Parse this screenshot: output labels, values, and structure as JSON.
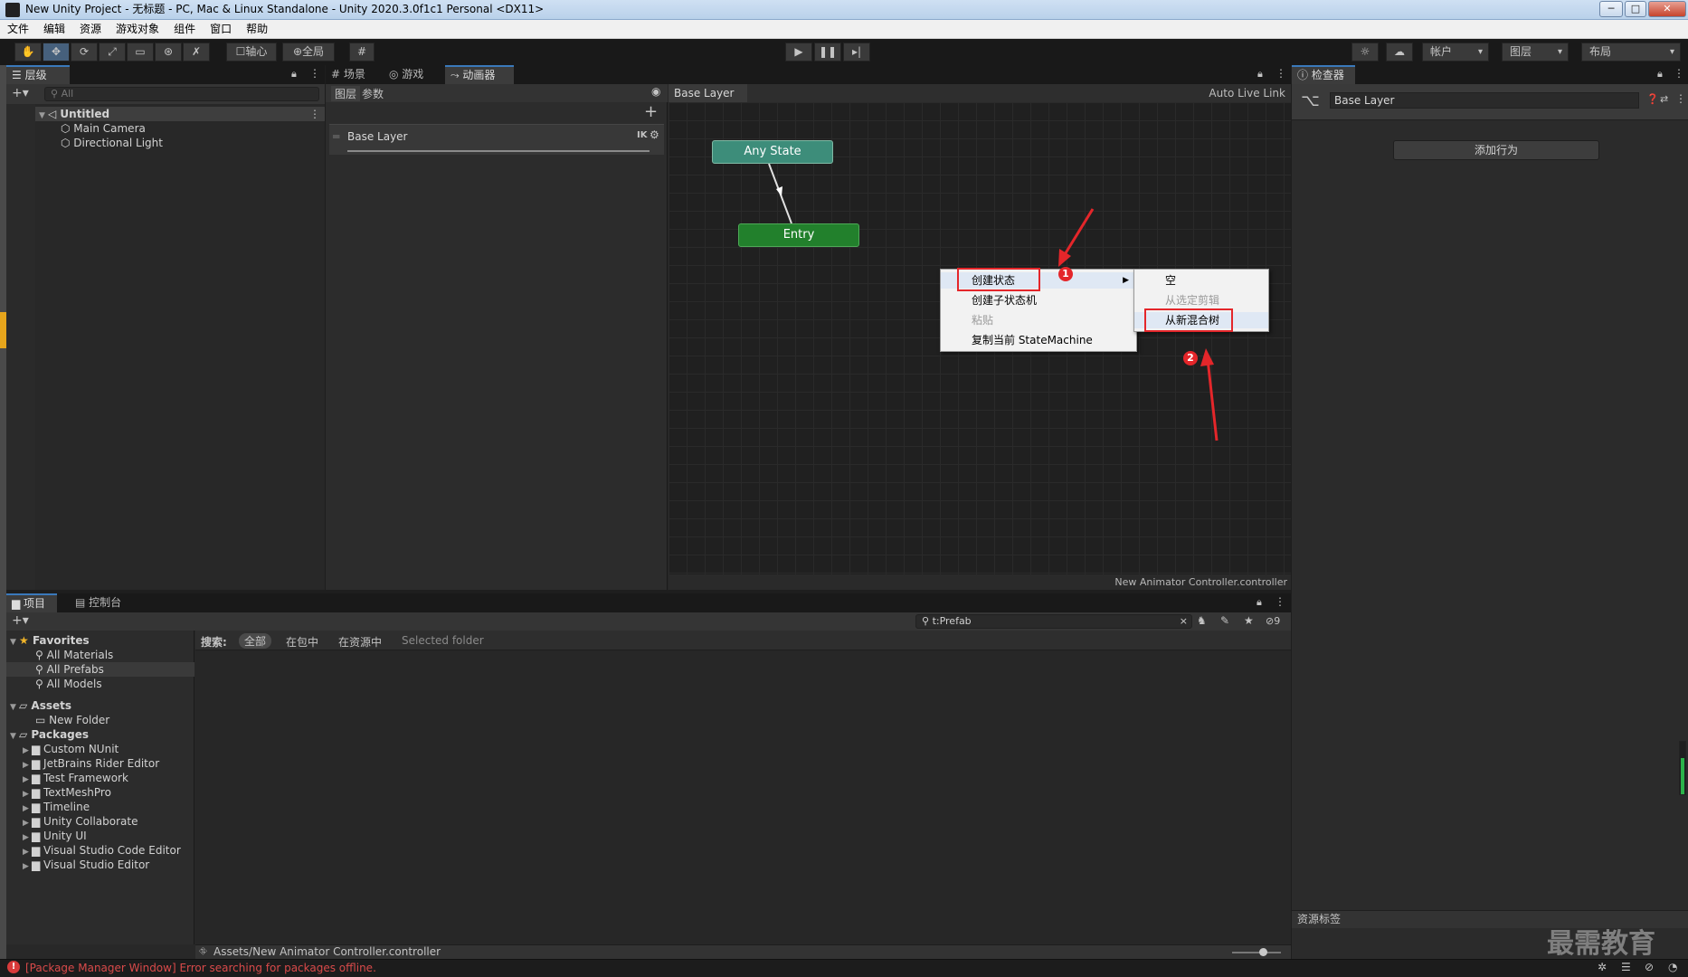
{
  "window": {
    "title": "New Unity Project - 无标题 - PC, Mac & Linux Standalone - Unity 2020.3.0f1c1 Personal <DX11>",
    "min": "─",
    "max": "□",
    "close": "✕"
  },
  "menu": [
    "文件",
    "编辑",
    "资源",
    "游戏对象",
    "组件",
    "窗口",
    "帮助"
  ],
  "toolbar": {
    "pivot": "轴心",
    "global": "全局",
    "account": "帐户",
    "layers": "图层",
    "layout": "布局"
  },
  "hierarchy": {
    "tab": "层级",
    "search_placeholder": "All",
    "scene": "Untitled",
    "objects": [
      "Main Camera",
      "Directional Light"
    ]
  },
  "center_tabs": [
    "场景",
    "游戏",
    "动画器"
  ],
  "animator": {
    "subtabs": [
      "图层",
      "参数"
    ],
    "breadcrumb": "Base Layer",
    "auto_live_link": "Auto Live Link",
    "layer_name": "Base Layer",
    "ik": "IK",
    "footer": "New Animator Controller.controller",
    "nodes": {
      "any_state": "Any State",
      "entry": "Entry"
    }
  },
  "context_menu": {
    "items": [
      "创建状态",
      "创建子状态机",
      "粘贴",
      "复制当前 StateMachine"
    ],
    "submenu": [
      "空",
      "从选定剪辑",
      "从新混合树"
    ]
  },
  "annotations": [
    "1",
    "2"
  ],
  "inspector": {
    "tab": "检查器",
    "title": "Base Layer",
    "add_behaviour": "添加行为",
    "asset_labels": "资源标签"
  },
  "project": {
    "tabs": [
      "项目",
      "控制台"
    ],
    "search_value": "t:Prefab",
    "hidden_count": "9",
    "search_label": "搜索:",
    "scopes": [
      "全部",
      "在包中",
      "在资源中",
      "Selected folder"
    ],
    "favorites": {
      "label": "Favorites",
      "items": [
        "All Materials",
        "All Prefabs",
        "All Models"
      ]
    },
    "assets": {
      "label": "Assets",
      "items": [
        "New Folder"
      ]
    },
    "packages": {
      "label": "Packages",
      "items": [
        "Custom NUnit",
        "JetBrains Rider Editor",
        "Test Framework",
        "TextMeshPro",
        "Timeline",
        "Unity Collaborate",
        "Unity UI",
        "Visual Studio Code Editor",
        "Visual Studio Editor"
      ]
    },
    "path": "Assets/New Animator Controller.controller"
  },
  "status": {
    "message": "[Package Manager Window] Error searching for packages offline."
  },
  "watermark": "最需教育",
  "colors": {
    "selection": "#2c5d87",
    "accent": "#3a79bb",
    "any_state": "#3a8c7a",
    "entry": "#217f2b",
    "annotation": "#e4262a"
  }
}
